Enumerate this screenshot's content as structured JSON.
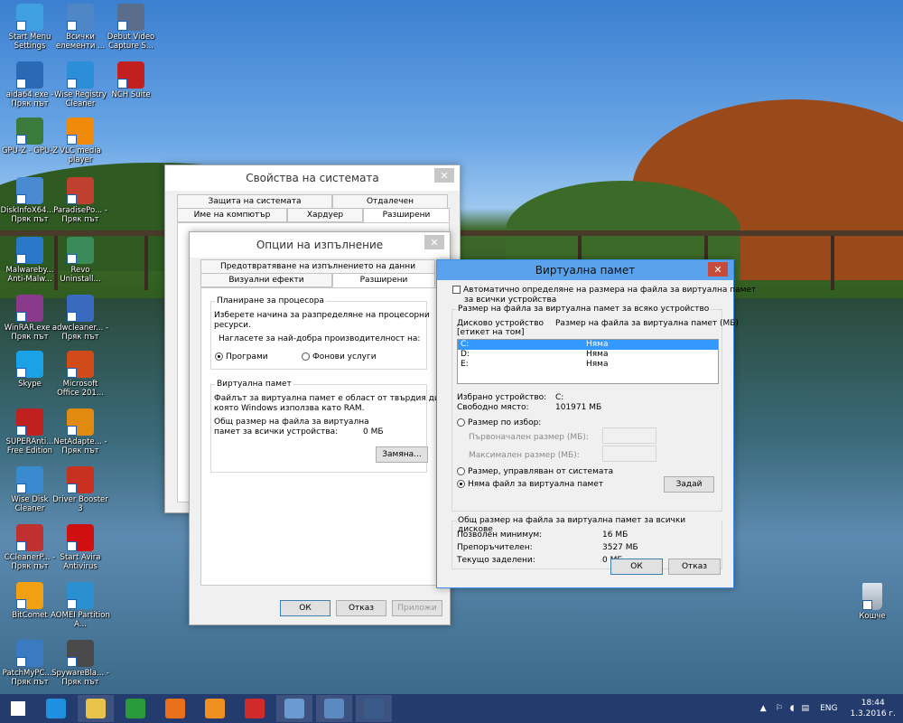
{
  "desktop_icons": [
    {
      "label": "Start Menu Settings",
      "icon": "settings-icon",
      "color": "#3fa0e0"
    },
    {
      "label": "Всички елементи ...",
      "icon": "control-panel-icon",
      "color": "#4f86c6"
    },
    {
      "label": "Debut Video Capture S...",
      "icon": "video-capture-icon",
      "color": "#5a6d8a"
    },
    {
      "label": "aida64.exe - Пряк път",
      "icon": "aida64-icon",
      "color": "#2a6ab5"
    },
    {
      "label": "Wise Registry Cleaner",
      "icon": "registry-cleaner-icon",
      "color": "#2b8ed6"
    },
    {
      "label": "NCH Suite",
      "icon": "nch-icon",
      "color": "#c22020"
    },
    {
      "label": "GPU-Z - GPU-Z",
      "icon": "gpuz-icon",
      "color": "#3a7a3a"
    },
    {
      "label": "VLC media player",
      "icon": "vlc-icon",
      "color": "#f08a0a"
    },
    {
      "label": "DiskInfoX64... - Пряк път",
      "icon": "diskinfo-icon",
      "color": "#4a8ad0"
    },
    {
      "label": "ParadisePo... - Пряк път",
      "icon": "paradise-icon",
      "color": "#c04030"
    },
    {
      "label": "Malwareby... Anti-Malw...",
      "icon": "malwarebytes-icon",
      "color": "#2a78c8"
    },
    {
      "label": "Revo Uninstall...",
      "icon": "revo-icon",
      "color": "#3a8a5a"
    },
    {
      "label": "WinRAR.exe - Пряк път",
      "icon": "winrar-icon",
      "color": "#8a3a8a"
    },
    {
      "label": "adwcleaner... - Пряк път",
      "icon": "adwcleaner-icon",
      "color": "#3a6ac0"
    },
    {
      "label": "Skype",
      "icon": "skype-icon",
      "color": "#1aa1e6"
    },
    {
      "label": "Microsoft Office 201...",
      "icon": "office-icon",
      "color": "#d04a1a"
    },
    {
      "label": "SUPERAnti... Free Edition",
      "icon": "superantispyware-icon",
      "color": "#c02020"
    },
    {
      "label": "NetAdapte... - Пряк път",
      "icon": "netadapter-icon",
      "color": "#e08a10"
    },
    {
      "label": "Wise Disk Cleaner",
      "icon": "disk-cleaner-icon",
      "color": "#3a8ad0"
    },
    {
      "label": "Driver Booster 3",
      "icon": "driver-booster-icon",
      "color": "#c83020"
    },
    {
      "label": "CCleanerP... - Пряк път",
      "icon": "ccleaner-icon",
      "color": "#c03030"
    },
    {
      "label": "Start Avira Antivirus",
      "icon": "avira-icon",
      "color": "#d01010"
    },
    {
      "label": "BitComet",
      "icon": "bitcomet-icon",
      "color": "#f0a010"
    },
    {
      "label": "AOMEI Partition A...",
      "icon": "aomei-icon",
      "color": "#2a90d0"
    },
    {
      "label": "PatchMyPC... - Пряк път",
      "icon": "patchmypc-icon",
      "color": "#3a7ac0"
    },
    {
      "label": "SpywareBla... - Пряк път",
      "icon": "spywareblaster-icon",
      "color": "#4a4a4a"
    }
  ],
  "recycle_bin": {
    "label": "Кошче",
    "icon": "recycle-bin-icon"
  },
  "sysprops": {
    "title": "Свойства на системата",
    "close": "✕",
    "tabs_top": [
      "Защита на системата",
      "Отдалечен"
    ],
    "tabs_bottom": [
      "Име на компютър",
      "Хардуер",
      "Разширени"
    ]
  },
  "perf": {
    "title": "Опции на изпълнение",
    "close": "✕",
    "tab_top": "Предотвратяване на изпълнението на данни",
    "tabs_bottom": [
      "Визуални ефекти",
      "Разширени"
    ],
    "sched": {
      "legend": "Планиране за процесора",
      "desc1": "Изберете начина за разпределяне на процесорни",
      "desc2": "ресурси.",
      "adjust": "Нагласете за най-добра производителност на:",
      "opt_programs": "Програми",
      "opt_services": "Фонови услуги"
    },
    "vm": {
      "legend": "Виртуална памет",
      "desc1": "Файлът за виртуална памет е област от твърдия диск,",
      "desc2": "която Windows използва като RAM.",
      "total1": "Общ размер на файла за виртуална",
      "total2": "памет за всички устройства:",
      "total_value": "0 МБ",
      "change": "Замяна..."
    },
    "ok": "ОК",
    "cancel": "Отказ",
    "apply": "Приложи"
  },
  "vmem": {
    "title": "Виртуална памет",
    "close": "✕",
    "auto1": "Автоматично определяне на размера на файла за виртуална памет",
    "auto2": "за всички устройства",
    "group_legend": "Размер на файла за виртуална памет за всяко устройство",
    "col_drive1": "Дисково устройство",
    "col_drive2": "[етикет на том]",
    "col_size": "Размер на файла за виртуална памет (МБ)",
    "drives": [
      {
        "drive": "C:",
        "size": "Няма",
        "selected": true
      },
      {
        "drive": "D:",
        "size": "Няма",
        "selected": false
      },
      {
        "drive": "E:",
        "size": "Няма",
        "selected": false
      }
    ],
    "sel_drive_label": "Избрано устройство:",
    "sel_drive_value": "C:",
    "free_label": "Свободно място:",
    "free_value": "101971 МБ",
    "custom": "Размер по избор:",
    "initial": "Първоначален размер (МБ):",
    "max": "Максимален размер (МБ):",
    "system": "Размер, управляван от системата",
    "nofile": "Няма файл за виртуална памет",
    "set": "Задай",
    "total_legend": "Общ размер на файла за виртуална памет за всички дискове",
    "min_label": "Позволен минимум:",
    "min_value": "16 МБ",
    "rec_label": "Препоръчителен:",
    "rec_value": "3527 МБ",
    "cur_label": "Текущо заделени:",
    "cur_value": "0 МБ",
    "ok": "ОК",
    "cancel": "Отказ"
  },
  "taskbar": {
    "items": [
      {
        "icon": "windows-start-icon",
        "color": "#ffffff",
        "running": false
      },
      {
        "icon": "internet-explorer-icon",
        "color": "#1e90e0",
        "running": false
      },
      {
        "icon": "file-explorer-icon",
        "color": "#e8c24a",
        "running": true
      },
      {
        "icon": "store-icon",
        "color": "#2a9a3a",
        "running": false
      },
      {
        "icon": "firefox-icon",
        "color": "#e8701a",
        "running": false
      },
      {
        "icon": "uc-browser-icon",
        "color": "#f09020",
        "running": false
      },
      {
        "icon": "vivaldi-icon",
        "color": "#d02a2a",
        "running": false
      },
      {
        "icon": "control-panel-icon",
        "color": "#6a9ad0",
        "running": true
      },
      {
        "icon": "system-properties-icon",
        "color": "#5a8ac0",
        "running": true
      },
      {
        "icon": "video-icon",
        "color": "#3a5a8a",
        "running": true
      }
    ],
    "lang": "ENG",
    "time": "18:44",
    "date": "1.3.2016 г."
  }
}
